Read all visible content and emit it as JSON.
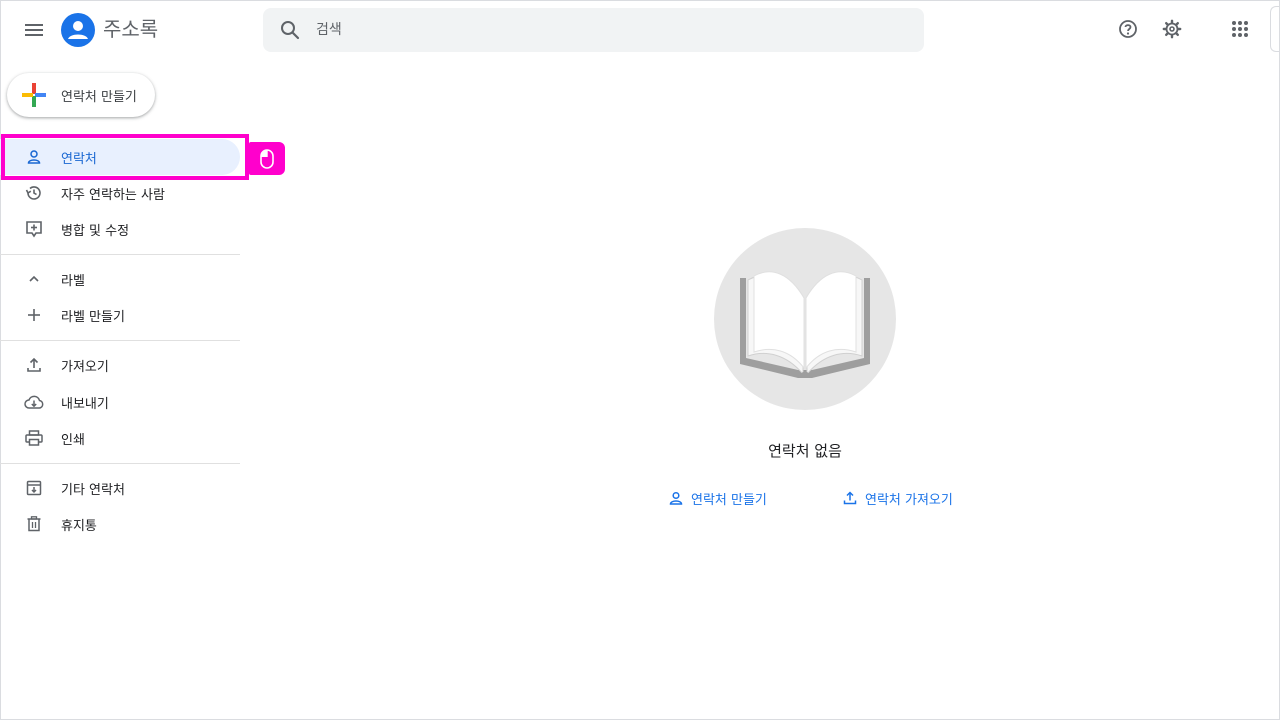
{
  "header": {
    "app_title": "주소록",
    "search_placeholder": "검색",
    "icons": [
      "menu-icon",
      "contacts-logo-icon",
      "search-icon",
      "help-icon",
      "settings-icon",
      "apps-grid-icon"
    ]
  },
  "create_button": {
    "label": "연락처 만들기"
  },
  "sidebar": {
    "items": [
      {
        "label": "연락처",
        "icon": "person-icon",
        "active": true
      },
      {
        "label": "자주 연락하는 사람",
        "icon": "history-icon"
      },
      {
        "label": "병합 및 수정",
        "icon": "merge-fix-icon"
      }
    ],
    "labels_section": {
      "label": "라벨",
      "icon": "chevron-up-icon"
    },
    "create_label": {
      "label": "라벨 만들기",
      "icon": "plus-icon"
    },
    "tools": [
      {
        "label": "가져오기",
        "icon": "upload-icon"
      },
      {
        "label": "내보내기",
        "icon": "cloud-download-icon"
      },
      {
        "label": "인쇄",
        "icon": "print-icon"
      }
    ],
    "other": [
      {
        "label": "기타 연락처",
        "icon": "archive-icon"
      },
      {
        "label": "휴지통",
        "icon": "trash-icon"
      }
    ]
  },
  "empty_state": {
    "title": "연락처 없음",
    "create_link": "연락처 만들기",
    "import_link": "연락처 가져오기"
  },
  "colors": {
    "accent": "#1a73e8",
    "active_bg": "#e8f0fe",
    "highlight": "#ff00cc",
    "search_bg": "#f1f3f4"
  }
}
